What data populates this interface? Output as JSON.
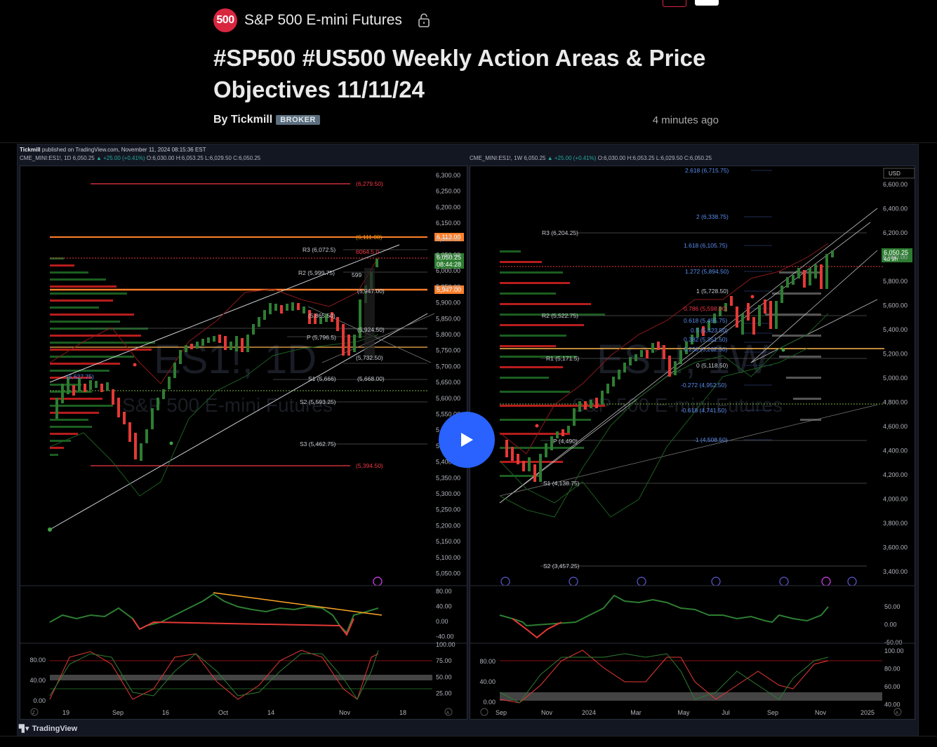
{
  "header": {
    "symbol_logo_text": "500",
    "symbol_name": "S&P 500 E-mini Futures",
    "title": "#SP500 #US500 Weekly Action Areas & Price Objectives 11/11/24",
    "byline_prefix": "By Tickmill",
    "author_badge": "BROKER",
    "timestamp": "4 minutes ago",
    "icons": {
      "lock": "lock-icon",
      "play": "play-icon"
    }
  },
  "chart_meta": {
    "published_line_author": "Tickmill",
    "published_line_rest": " published on TradingView.com, November 11, 2024 08:15:36 EST",
    "tradingview_logo": "TradingView"
  },
  "left_chart": {
    "ticker_line_a": "CME_MINI:ES1!, 1D  6,050.25",
    "ticker_line_change": " ▲ +25.00 (+0.41%)",
    "ticker_line_b": " O:6,030.00  H:6,053.25  L:6,029.50  C:6,050.25",
    "watermark": "ES1!, 1D",
    "watermark_sub": "S&P 500 E-mini Futures",
    "price_axis": [
      "6,300.00",
      "6,250.00",
      "6,200.00",
      "6,150.00",
      "6,100.00",
      "6,050.00",
      "6,000.00",
      "5,950.00",
      "5,900.00",
      "5,850.00",
      "5,800.00",
      "5,750.00",
      "5,700.00",
      "5,650.00",
      "5,600.00",
      "5,550.00",
      "5,500.00",
      "5,450.00",
      "5,400.00",
      "5,350.00",
      "5,300.00",
      "5,250.00",
      "5,200.00",
      "5,150.00",
      "5,100.00",
      "5,050.00"
    ],
    "price_tags": {
      "upper": "6,113.00",
      "last": "6,050.25",
      "countdown": "08:44:28",
      "lower": "5,947.00"
    },
    "levels": {
      "top_red": "(6,279.50)",
      "fib_top": "(6,111.00)",
      "r3": "R3 (6,072.5)",
      "r3b": "6064.5  0",
      "r2": "R2 (5,999.75)",
      "lbl_599": "599",
      "lbl_5947": "(5,947.00)",
      "lbl_5924": "(5,924.50)",
      "lbl_5865": "(5,865.50)",
      "pivot": "P (5,796.5)",
      "lbl_5732": "(5,732.50)",
      "lbl_5627": "(5,627.75)",
      "s1": "S1 (5,666)",
      "lbl_5668": "(5,668.00)",
      "s2": "S2 (5,593.25)",
      "s3": "S3 (5,462.75)",
      "bottom_red": "(5,394.50)"
    },
    "osc1_axis": [
      "80.00",
      "40.00",
      "0.00",
      "-40.00"
    ],
    "osc2_axis_left": [
      "80.00",
      "40.00",
      "0.00"
    ],
    "osc2_axis_right": [
      "100.00",
      "75.00",
      "50.00",
      "25.00"
    ],
    "time_axis": [
      "19",
      "Sep",
      "16",
      "Oct",
      "14",
      "Nov",
      "18"
    ]
  },
  "right_chart": {
    "ticker_line_a": "CME_MINI:ES1!, 1W  6,050.25",
    "ticker_line_change": " ▲ +25.00 (+0.41%)",
    "ticker_line_b": " O:6,030.00  H:6,053.25  L:6,029.50  C:6,050.25",
    "watermark": "ES1!, 1W",
    "watermark_sub": "S&P 500 E-mini Futures",
    "currency": "USD",
    "price_axis": [
      "6,600.00",
      "6,400.00",
      "6,200.00",
      "6,000.00",
      "5,800.00",
      "5,600.00",
      "5,400.00",
      "5,200.00",
      "5,000.00",
      "4,800.00",
      "4,600.00",
      "4,400.00",
      "4,200.00",
      "4,000.00",
      "3,800.00",
      "3,600.00",
      "3,400.00"
    ],
    "price_tags": {
      "last": "6,050.25",
      "countdown": "4d 9h"
    },
    "levels": {
      "f2618": "2.618 (6,715.75)",
      "f2": "2 (6,338.75)",
      "r3": "R3 (6,204.25)",
      "f1618": "1.618 (6,105.75)",
      "f1272": "1.272 (5,894.50)",
      "f1": "1 (5,728.50)",
      "f0786": "0.786 (5,598.00)",
      "r2": "R2 (5,522.75)",
      "f0618": "0.618 (5,495.75)",
      "f05": "0.5 (5,423.50)",
      "f0382": "0.382 (5,351.50)",
      "f0236": "0.236 (5,262.50)",
      "r1": "R1 (5,171.5)",
      "f0": "0 (5,118.50)",
      "fn0272": "-0.272 (4,952.50)",
      "fn0618": "-0.618 (4,741.50)",
      "fn1": "-1 (4,508.50)",
      "pivot": "P (4,490)",
      "s1": "S1 (4,138.75)",
      "s2": "S2 (3,457.25)"
    },
    "osc1_axis": [
      "50.00",
      "0.00",
      "-50.00"
    ],
    "osc2_axis_left": [
      "80.00",
      "40.00",
      "0.00"
    ],
    "osc2_axis_right": [
      "100.00",
      "80.00",
      "60.00",
      "40.00"
    ],
    "time_axis": [
      "Sep",
      "Nov",
      "2024",
      "Mar",
      "May",
      "Jul",
      "Sep",
      "Nov",
      "2025"
    ]
  }
}
